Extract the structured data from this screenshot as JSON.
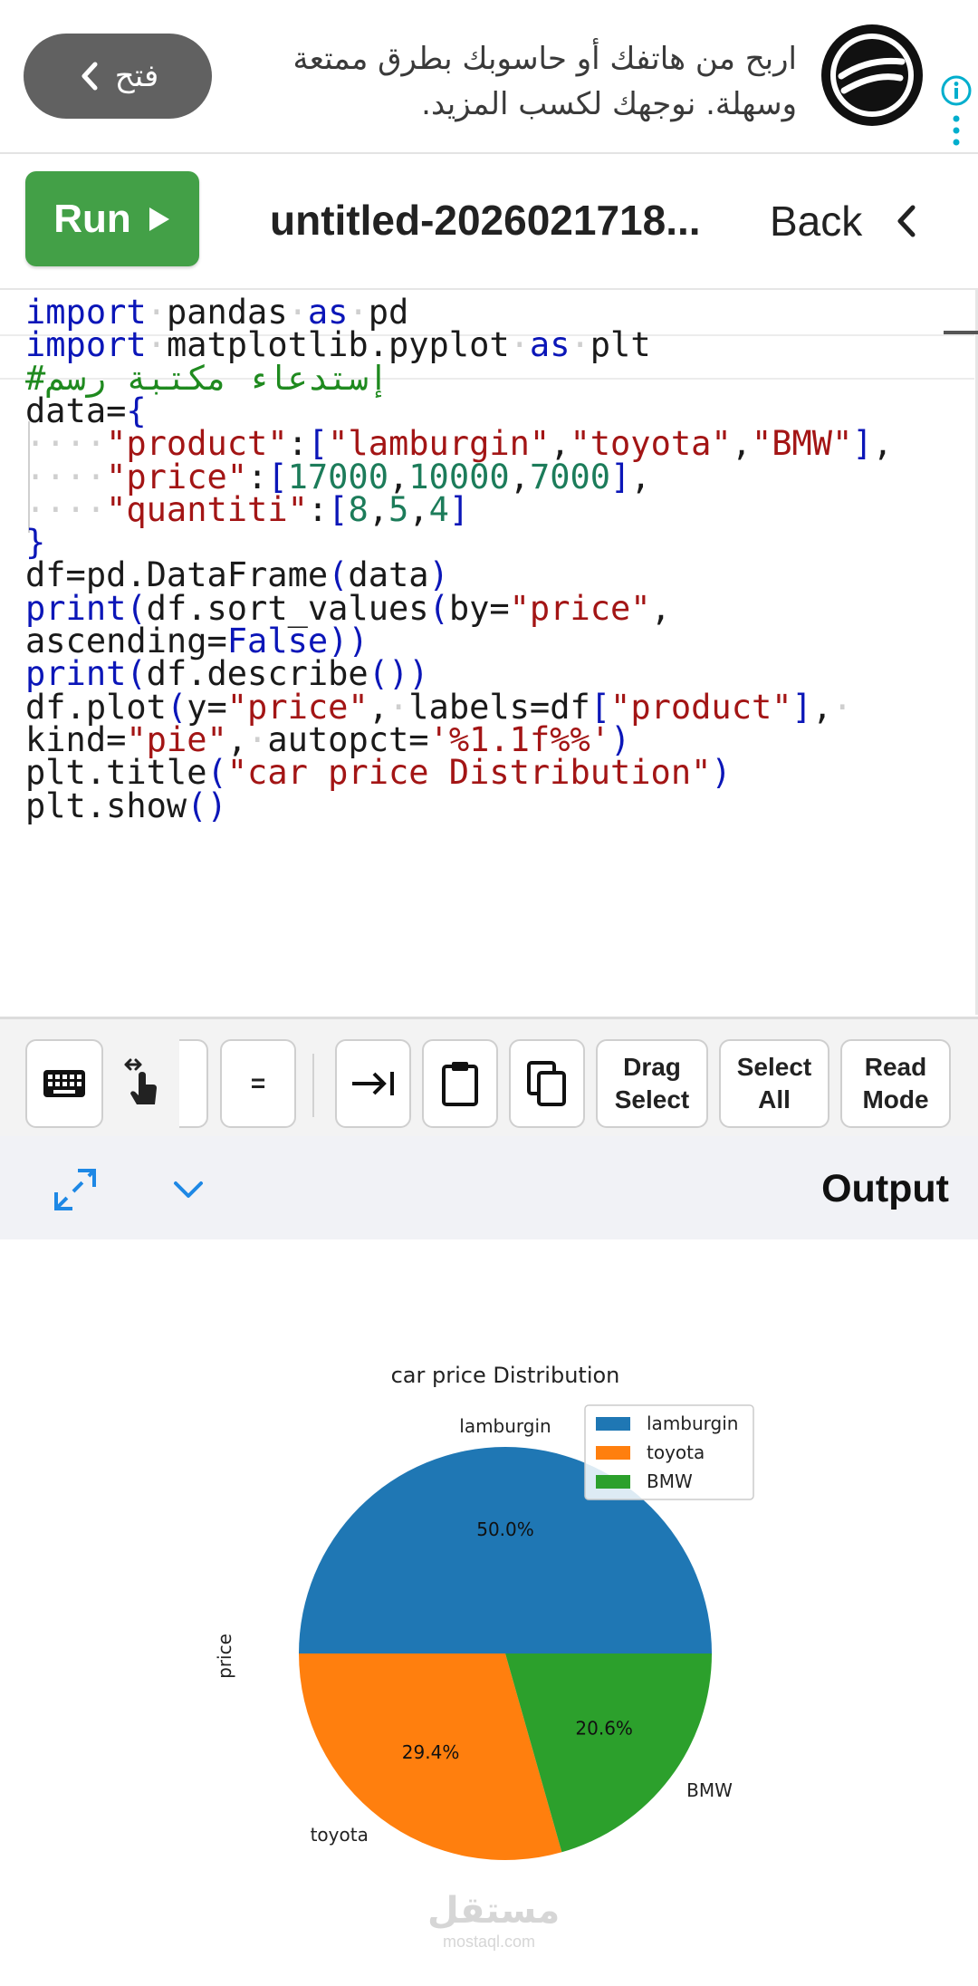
{
  "ad": {
    "open_label": "فتح",
    "text_line1": "اربح من هاتفك أو حاسوبك بطرق ممتعة",
    "text_line2": "وسهلة. نوجهك لكسب المزيد.",
    "icons": [
      "chevron-left-icon",
      "brand-logo",
      "info-icon",
      "more-vertical-icon"
    ]
  },
  "toolbar": {
    "run_label": "Run",
    "file_title": "untitled-2026021718...",
    "back_label": "Back"
  },
  "editor": {
    "lines": [
      "import pandas as pd",
      "import matplotlib.pyplot as plt",
      "#إستدعاء مكتبة رسم",
      "data={",
      "    \"product\":[\"lamburgin\",\"toyota\",\"BMW\"],",
      "    \"price\":[17000,10000,7000],",
      "    \"quantiti\":[8,5,4]",
      "}",
      "df=pd.DataFrame(data)",
      "print(df.sort_values(by=\"price\",",
      "ascending=False))",
      "print(df.describe())",
      "df.plot(y=\"price\", labels=df[\"product\"], ",
      "kind=\"pie\", autopct='%1.1f%%')",
      "plt.title(\"car price Distribution\")",
      "plt.show()"
    ]
  },
  "keybar": {
    "equals_label": "=",
    "drag_select_line1": "Drag",
    "drag_select_line2": "Select",
    "select_all_line1": "Select",
    "select_all_line2": "All",
    "read_mode_line1": "Read",
    "read_mode_line2": "Mode"
  },
  "output": {
    "title": "Output"
  },
  "watermark": {
    "arabic": "مستقل",
    "latin": "mostaql.com"
  },
  "colors": {
    "run_green": "#43a047",
    "keyword_blue": "#0b16b8",
    "string_red": "#a31515",
    "number_teal": "#1c7c5a",
    "comment_green": "#1f8a1f",
    "series_blue": "#1f77b4",
    "series_orange": "#ff7f0e",
    "series_green": "#2ca02c"
  },
  "chart_data": {
    "type": "pie",
    "title": "car price Distribution",
    "ylabel": "price",
    "categories": [
      "lamburgin",
      "toyota",
      "BMW"
    ],
    "values": [
      17000,
      10000,
      7000
    ],
    "percent_labels": [
      "50.0%",
      "29.4%",
      "20.6%"
    ],
    "colors": [
      "#1f77b4",
      "#ff7f0e",
      "#2ca02c"
    ],
    "legend": [
      "lamburgin",
      "toyota",
      "BMW"
    ],
    "legend_position": "upper-right"
  }
}
